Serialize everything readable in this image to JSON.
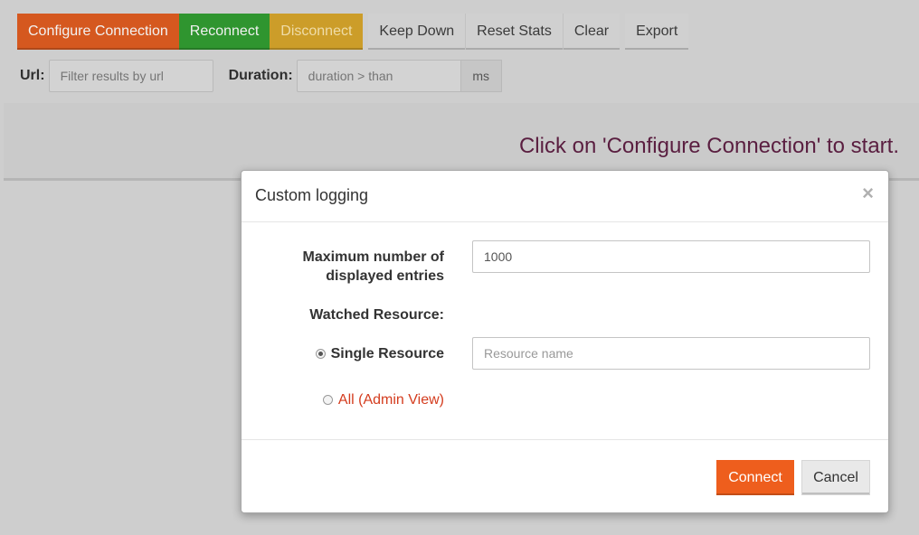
{
  "toolbar": {
    "configure_label": "Configure Connection",
    "reconnect_label": "Reconnect",
    "disconnect_label": "Disconnect",
    "keep_down_label": "Keep Down",
    "reset_stats_label": "Reset Stats",
    "clear_label": "Clear",
    "export_label": "Export"
  },
  "filters": {
    "url_label": "Url:",
    "url_placeholder": "Filter results by url",
    "duration_label": "Duration:",
    "duration_placeholder": "duration > than",
    "duration_unit": "ms"
  },
  "main": {
    "start_message": "Click on 'Configure Connection' to start."
  },
  "modal": {
    "title": "Custom logging",
    "close_icon": "×",
    "max_entries_label_line1": "Maximum number of",
    "max_entries_label_line2": "displayed entries",
    "max_entries_value": "1000",
    "watched_resource_label": "Watched Resource:",
    "single_resource_label": "Single Resource",
    "resource_name_placeholder": "Resource name",
    "all_admin_label": "All (Admin View)",
    "connect_label": "Connect",
    "cancel_label": "Cancel"
  },
  "colors": {
    "configure": "#d5581f",
    "reconnect": "#2f952f",
    "disconnect": "#cc9d29",
    "connect": "#ee5e1d",
    "start_message": "#5a1e40",
    "admin_view": "#d43c1e"
  }
}
